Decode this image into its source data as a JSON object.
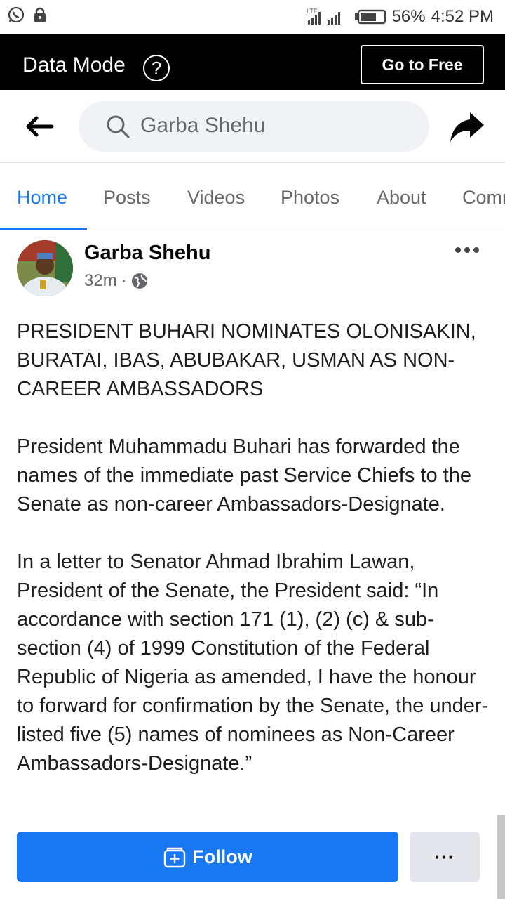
{
  "status_bar": {
    "battery": "56%",
    "time": "4:52 PM",
    "network": "LTE",
    "icons": [
      "whatsapp-icon",
      "lock-icon",
      "signal-icon",
      "battery-icon"
    ]
  },
  "data_mode": {
    "title": "Data Mode",
    "help": "?",
    "go_free_label": "Go to Free"
  },
  "search": {
    "query": "Garba Shehu"
  },
  "tabs": [
    {
      "label": "Home",
      "active": true
    },
    {
      "label": "Posts",
      "active": false
    },
    {
      "label": "Videos",
      "active": false
    },
    {
      "label": "Photos",
      "active": false
    },
    {
      "label": "About",
      "active": false
    },
    {
      "label": "Comm",
      "active": false
    }
  ],
  "post": {
    "author": "Garba Shehu",
    "time": "32m",
    "separator": "·",
    "headline": "PRESIDENT BUHARI NOMINATES OLONISAKIN, BURATAI, IBAS, ABUBAKAR, USMAN AS NON-CAREER AMBASSADORS",
    "paragraph1": "President Muhammadu Buhari has forwarded the names of the immediate past Service Chiefs to the Senate as non-career Ambassadors-Designate.",
    "paragraph2": "In a letter to Senator Ahmad Ibrahim Lawan, President of the Senate, the President said: “In accordance with section 171 (1), (2) (c) & sub-section (4) of 1999 Constitution of the Federal Republic of Nigeria as amended, I have the honour to forward for confirmation by the Senate, the under-listed five (5) names of nominees as Non-Career Ambassadors-Designate.”"
  },
  "bottom": {
    "follow_label": "Follow",
    "more": "···"
  },
  "colors": {
    "accent": "#1877f2",
    "databar_bg": "#000000",
    "secondary_text": "#65676b"
  }
}
